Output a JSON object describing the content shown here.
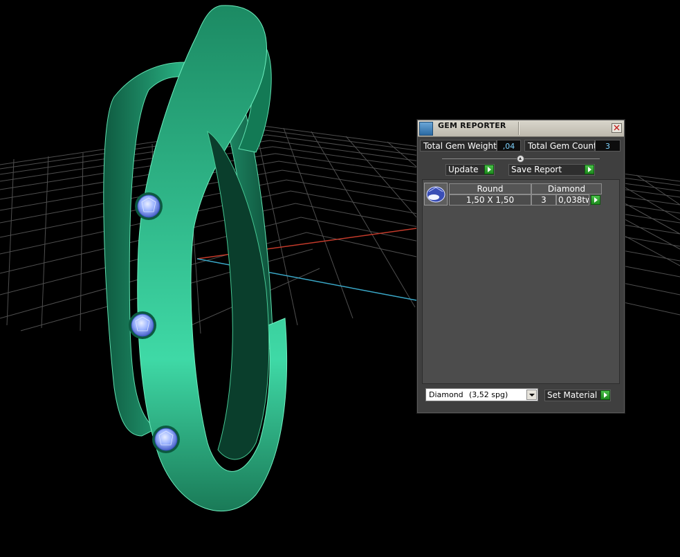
{
  "window": {
    "title": "GEM REPORTER",
    "close_icon": "close-icon"
  },
  "summary": {
    "total_weight_label": "Total Gem Weight",
    "total_weight_value": ",04",
    "total_count_label": "Total Gem Count",
    "total_count_value": "3"
  },
  "actions": {
    "update_label": "Update",
    "save_report_label": "Save Report"
  },
  "gem_table": {
    "headers": [
      "Round",
      "Diamond"
    ],
    "rows": [
      {
        "icon": "round-gem-icon",
        "size": "1,50 X 1,50",
        "count": "3",
        "weight": "0,038tw"
      }
    ]
  },
  "material": {
    "selected_name": "Diamond",
    "selected_density": "(3,52 spg)",
    "set_material_label": "Set Material"
  },
  "colors": {
    "panel_bg": "#3f3f3f",
    "list_bg": "#4c4c4c",
    "value_text": "#7fd4ff",
    "button_green": "#2ea52e",
    "ring_green": "#1f8a63",
    "gem_blue": "#9fb8ff",
    "axis_red": "#c43a2a",
    "axis_blue": "#3aa8c8"
  }
}
